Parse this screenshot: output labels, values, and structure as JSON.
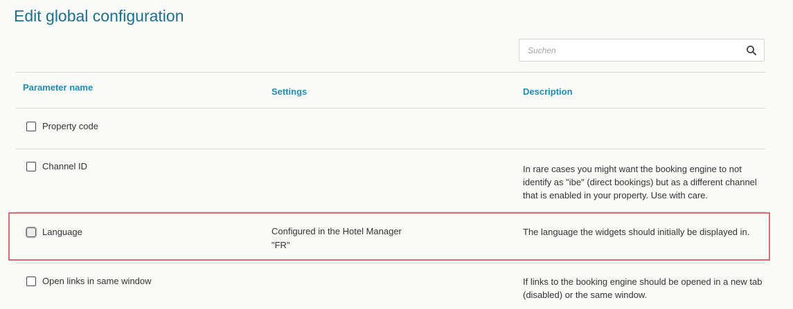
{
  "page": {
    "title": "Edit global configuration"
  },
  "search": {
    "placeholder": "Suchen",
    "value": "",
    "icon": "search-icon"
  },
  "table": {
    "headers": {
      "parameter_name": "Parameter name",
      "settings": "Settings",
      "description": "Description"
    },
    "rows": [
      {
        "label": "Property code",
        "checked": false,
        "settings": [],
        "description": ""
      },
      {
        "label": "Channel ID",
        "checked": false,
        "settings": [],
        "description": "In rare cases you might want the booking engine to not identify as \"ibe\" (direct bookings) but as a different channel that is enabled in your property. Use with care."
      },
      {
        "label": "Language",
        "checked": false,
        "highlighted": true,
        "settings": [
          "Configured in the Hotel Manager",
          "\"FR\""
        ],
        "description": "The language the widgets should initially be displayed in."
      },
      {
        "label": "Open links in same window",
        "checked": false,
        "settings": [],
        "description": "If links to the booking engine should be opened in a new tab (disabled) or the same window."
      }
    ]
  },
  "colors": {
    "title": "#1b7090",
    "header": "#1a8db8",
    "highlight_border": "#e06a72"
  }
}
